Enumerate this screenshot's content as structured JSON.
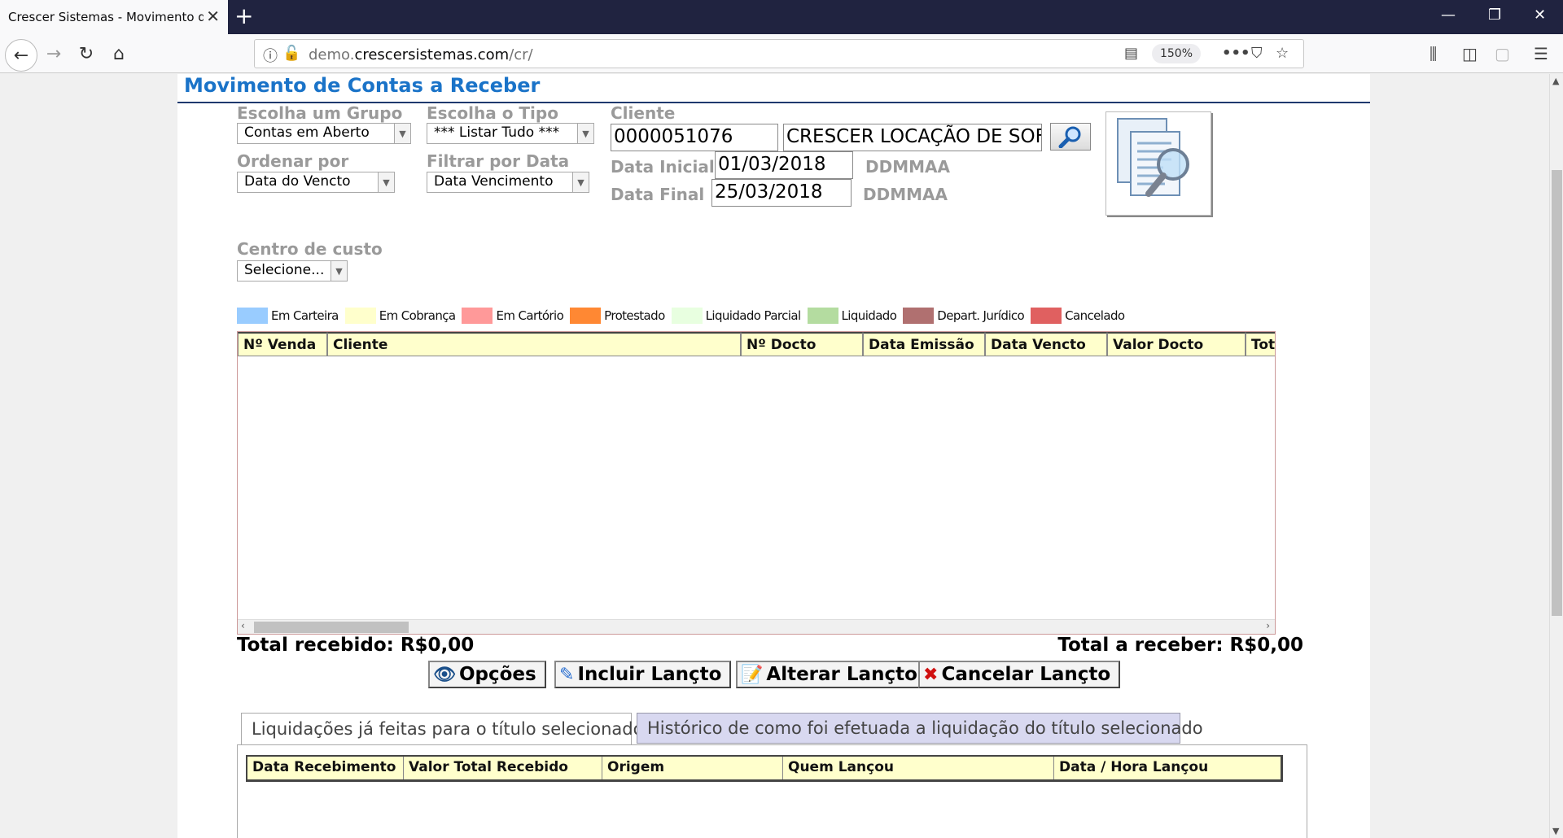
{
  "browser": {
    "tab_title": "Crescer Sistemas - Movimento de C",
    "url_domain": "crescersistemas.com",
    "url_prefix": "demo.",
    "url_path": "/cr/",
    "zoom": "150%"
  },
  "page": {
    "title": "Movimento de Contas a Receber"
  },
  "filters": {
    "grupo_label": "Escolha um Grupo",
    "grupo_value": "Contas em Aberto",
    "tipo_label": "Escolha o Tipo",
    "tipo_value": "*** Listar Tudo ***",
    "cliente_label": "Cliente",
    "cliente_code": "0000051076",
    "cliente_name": "CRESCER LOCAÇÃO DE SOF",
    "ordenar_label": "Ordenar por",
    "ordenar_value": "Data do Vencto",
    "filtrar_label": "Filtrar por Data",
    "filtrar_value": "Data Vencimento",
    "data_inicial_label": "Data Inicial",
    "data_inicial_value": "01/03/2018",
    "data_final_label": "Data Final",
    "data_final_value": "25/03/2018",
    "date_hint": "DDMMAA",
    "centro_label": "Centro de custo",
    "centro_value": "Selecione..."
  },
  "legend": [
    {
      "label": "Em Carteira",
      "color": "#99ccff"
    },
    {
      "label": "Em Cobrança",
      "color": "#ffffcc"
    },
    {
      "label": "Em Cartório",
      "color": "#ff9999"
    },
    {
      "label": "Protestado",
      "color": "#ff8833"
    },
    {
      "label": "Liquidado Parcial",
      "color": "#e8ffe0"
    },
    {
      "label": "Liquidado",
      "color": "#b4dca0"
    },
    {
      "label": "Depart. Jurídico",
      "color": "#b07070"
    },
    {
      "label": "Cancelado",
      "color": "#e06060"
    }
  ],
  "grid": {
    "columns": [
      "Nº Venda",
      "Cliente",
      "Nº Docto",
      "Data Emissão",
      "Data Vencto",
      "Valor Docto",
      "Total"
    ]
  },
  "totals": {
    "recebido": "Total recebido: R$0,00",
    "a_receber": "Total a receber: R$0,00"
  },
  "actions": {
    "opcoes": "Opções",
    "incluir": "Incluir Lançto",
    "alterar": "Alterar Lançto",
    "cancelar": "Cancelar Lançto"
  },
  "tabs": {
    "liquidacoes": "Liquidações já feitas para o título selecionado",
    "historico": "Histórico de como foi efetuada a liquidação do título selecionado"
  },
  "liquidacoes_grid": {
    "columns": [
      "Data Recebimento",
      "Valor Total Recebido",
      "Origem",
      "Quem Lançou",
      "Data / Hora Lançou"
    ]
  }
}
